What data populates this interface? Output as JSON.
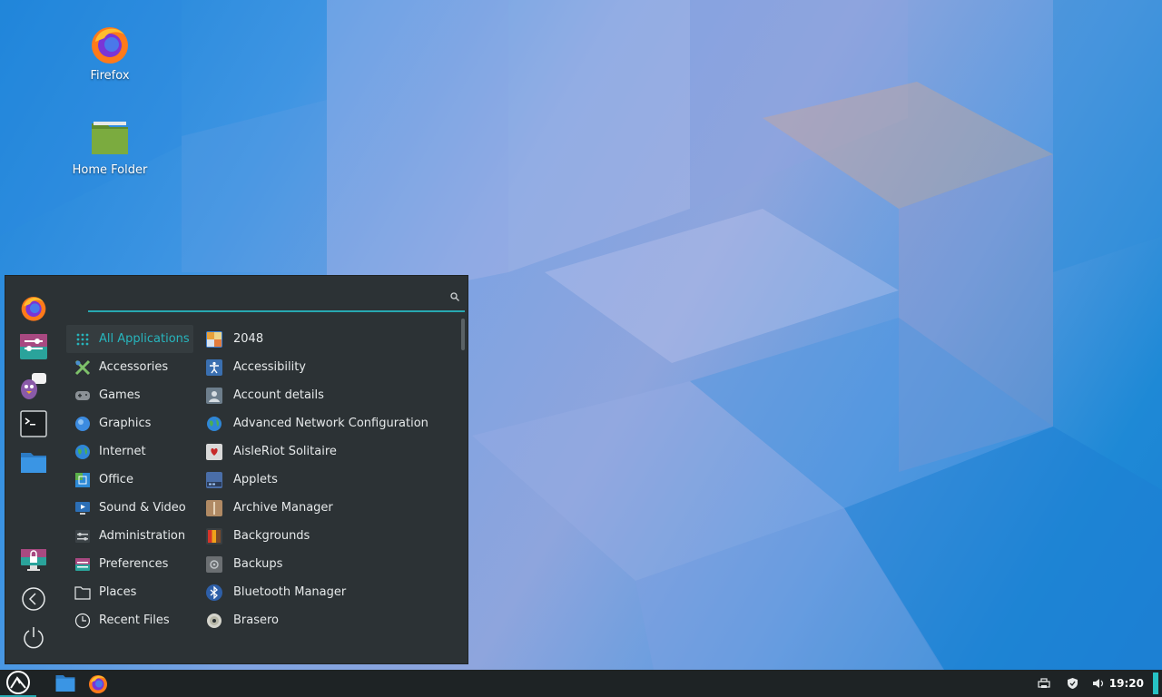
{
  "desktop": {
    "icons": [
      {
        "label": "Firefox",
        "icon": "firefox-icon"
      },
      {
        "label": "Home Folder",
        "icon": "folder-icon"
      }
    ]
  },
  "menu": {
    "search": {
      "value": "",
      "placeholder": ""
    },
    "favorites": [
      "firefox-icon",
      "settings-icon",
      "pidgin-icon",
      "terminal-icon",
      "files-icon"
    ],
    "session": [
      "lock-screen-icon",
      "logout-icon",
      "power-icon"
    ],
    "categories": [
      {
        "label": "All Applications",
        "icon": "grid-icon",
        "active": true
      },
      {
        "label": "Accessories",
        "icon": "accessories-icon"
      },
      {
        "label": "Games",
        "icon": "gamepad-icon"
      },
      {
        "label": "Graphics",
        "icon": "graphics-icon"
      },
      {
        "label": "Internet",
        "icon": "globe-icon"
      },
      {
        "label": "Office",
        "icon": "office-icon"
      },
      {
        "label": "Sound & Video",
        "icon": "media-icon"
      },
      {
        "label": "Administration",
        "icon": "admin-icon"
      },
      {
        "label": "Preferences",
        "icon": "preferences-icon"
      },
      {
        "label": "Places",
        "icon": "folder-outline-icon"
      },
      {
        "label": "Recent Files",
        "icon": "clock-icon"
      }
    ],
    "apps": [
      {
        "label": "2048",
        "icon": "2048-icon",
        "color": "#3c7fd2"
      },
      {
        "label": "Accessibility",
        "icon": "accessibility-icon",
        "color": "#3a6fb0"
      },
      {
        "label": "Account details",
        "icon": "account-icon",
        "color": "#6d7e8c"
      },
      {
        "label": "Advanced Network Configuration",
        "icon": "network-icon",
        "color": "#3d9b5c"
      },
      {
        "label": "AisleRiot Solitaire",
        "icon": "cards-icon",
        "color": "#d9d9d9"
      },
      {
        "label": "Applets",
        "icon": "applets-icon",
        "color": "#4a6ea8"
      },
      {
        "label": "Archive Manager",
        "icon": "archive-icon",
        "color": "#b08a64"
      },
      {
        "label": "Backgrounds",
        "icon": "backgrounds-icon",
        "color": "#c7752a"
      },
      {
        "label": "Backups",
        "icon": "backups-icon",
        "color": "#6b6f72"
      },
      {
        "label": "Bluetooth Manager",
        "icon": "bluetooth-icon",
        "color": "#2e5fa8"
      },
      {
        "label": "Brasero",
        "icon": "disc-icon",
        "color": "#c9c9c9"
      }
    ]
  },
  "panel": {
    "clock": "19:20"
  }
}
